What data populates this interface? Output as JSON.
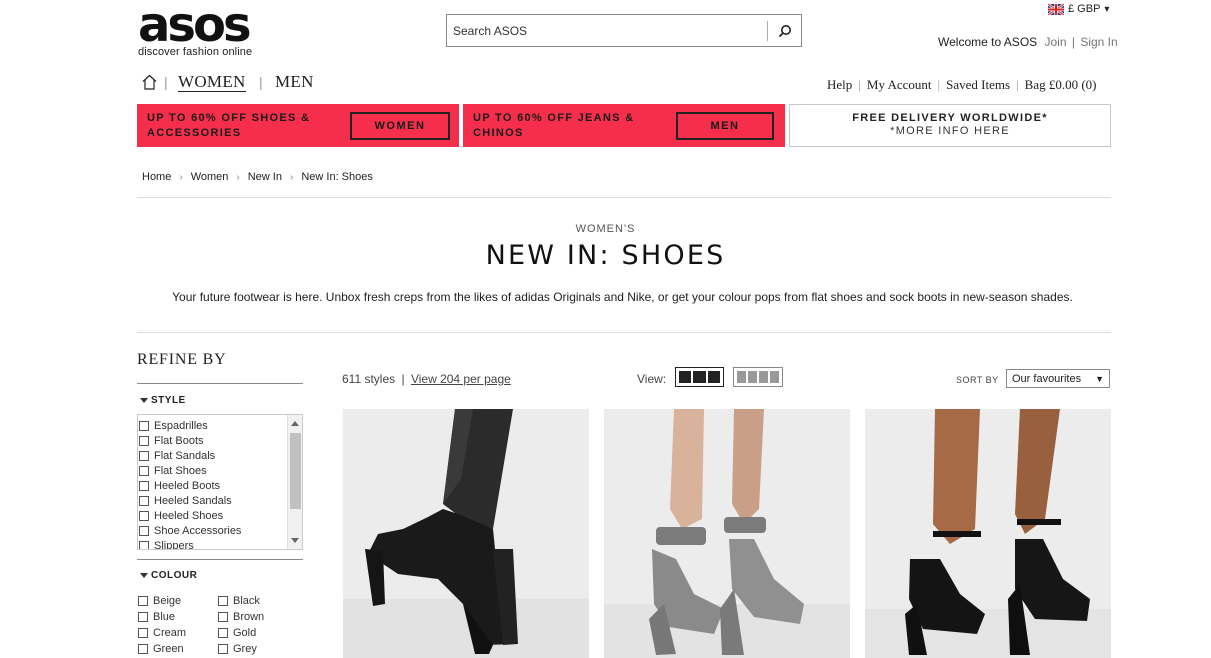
{
  "brand": {
    "logo_text": "asos",
    "tagline": "discover fashion online"
  },
  "search": {
    "placeholder": "Search ASOS"
  },
  "currency": {
    "label": "£ GBP",
    "caret": "▾"
  },
  "account": {
    "welcome": "Welcome to ASOS",
    "join": "Join",
    "divider": "|",
    "sign_in": "Sign In"
  },
  "nav": {
    "women": "WOMEN",
    "men": "MEN",
    "separator": "|"
  },
  "utility_links": {
    "help": "Help",
    "my_account": "My Account",
    "saved_items": "Saved Items",
    "bag": "Bag £0.00 (0)",
    "separator": "|"
  },
  "promos": [
    {
      "text_line1": "UP TO 60% OFF SHOES &",
      "text_line2": "ACCESSORIES",
      "button": "WOMEN"
    },
    {
      "text_line1": "UP TO 60% OFF JEANS &",
      "text_line2": "CHINOS",
      "button": "MEN"
    },
    {
      "line1": "FREE DELIVERY WORLDWIDE*",
      "line2": "*MORE INFO HERE"
    }
  ],
  "breadcrumb": [
    "Home",
    "Women",
    "New In",
    "New In: Shoes"
  ],
  "breadcrumb_separator": "›",
  "page": {
    "subtitle": "WOMEN'S",
    "title": "NEW IN: SHOES",
    "description": "Your future footwear is here. Unbox fresh creps from the likes of adidas Originals and Nike, or get your colour pops from flat shoes and sock boots in new-season shades."
  },
  "refine": {
    "title": "REFINE BY",
    "style_heading": "STYLE",
    "style_options": [
      "Espadrilles",
      "Flat Boots",
      "Flat Sandals",
      "Flat Shoes",
      "Heeled Boots",
      "Heeled Sandals",
      "Heeled Shoes",
      "Shoe Accessories",
      "Slippers"
    ],
    "colour_heading": "COLOUR",
    "colour_options": [
      "Beige",
      "Black",
      "Blue",
      "Brown",
      "Cream",
      "Gold",
      "Green",
      "Grey"
    ]
  },
  "results": {
    "count": "611 styles",
    "divider": "|",
    "per_page_link": "View 204 per page",
    "view_label": "View:",
    "sort_label": "SORT BY",
    "sort_value": "Our favourites",
    "sort_caret": "▼"
  },
  "colors": {
    "promo_red": "#f52f4b",
    "text_dark": "#222222",
    "product_bg": "#eaeaea"
  },
  "icons": {
    "home": "home-icon",
    "search": "magnifier-icon",
    "flag": "union-jack-icon"
  }
}
